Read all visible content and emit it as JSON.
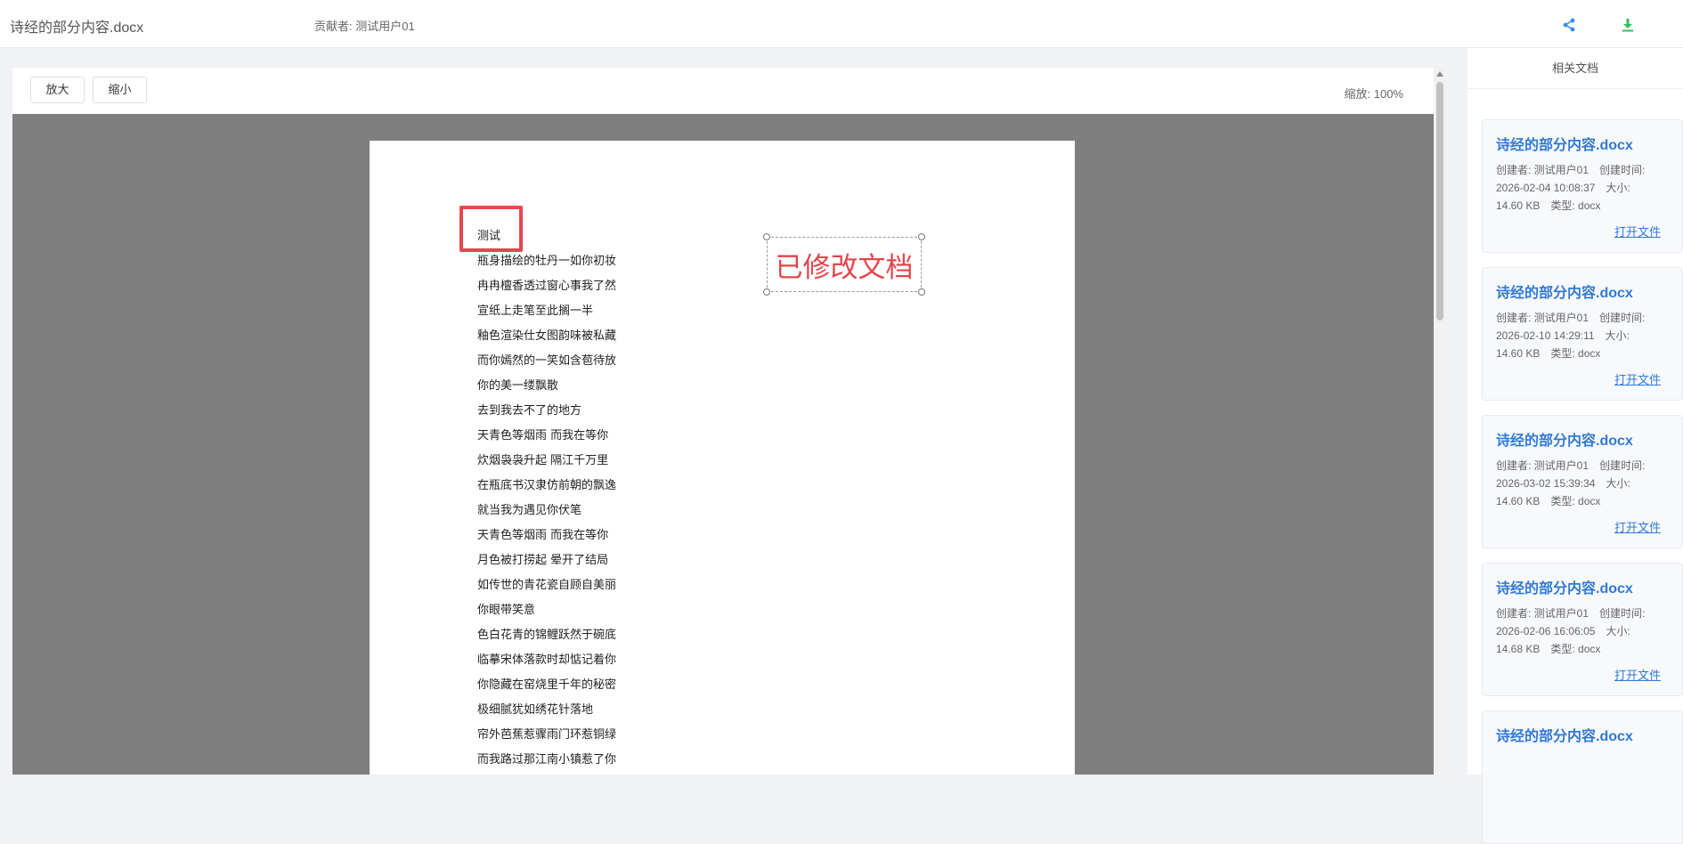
{
  "header": {
    "doc_title": "诗经的部分内容.docx",
    "contributor": "贡献者: 测试用户01",
    "share_icon": "share-icon",
    "download_icon": "download-icon",
    "colors": {
      "share": "#3a8ee6",
      "download": "#3cba5b"
    }
  },
  "toolbar": {
    "zoom_in_label": "放大",
    "zoom_out_label": "缩小",
    "zoom_level": "缩放: 100%"
  },
  "document": {
    "highlight_text": "测试",
    "stamp_text": "已修改文档",
    "lines": [
      "瓶身描绘的牡丹一如你初妆",
      "冉冉檀香透过窗心事我了然",
      "宣纸上走笔至此搁一半",
      "釉色渲染仕女图韵味被私藏",
      "而你嫣然的一笑如含苞待放",
      "你的美一缕飘散",
      "去到我去不了的地方",
      "天青色等烟雨 而我在等你",
      "炊烟袅袅升起 隔江千万里",
      "在瓶底书汉隶仿前朝的飘逸",
      "就当我为遇见你伏笔",
      "天青色等烟雨 而我在等你",
      "月色被打捞起 晕开了结局",
      "如传世的青花瓷自顾自美丽",
      "你眼带笑意",
      "色白花青的锦鲤跃然于碗底",
      "临摹宋体落款时却惦记着你",
      "你隐藏在窑烧里千年的秘密",
      "极细腻犹如绣花针落地",
      "帘外芭蕉惹骤雨门环惹铜绿",
      "而我路过那江南小镇惹了你"
    ]
  },
  "sidebar": {
    "title": "相关文档",
    "cards": [
      {
        "title": "诗经的部分内容.docx",
        "meta1": "创建者: 测试用户01　创建时间:",
        "meta2": "2026-02-04 10:08:37　大小:",
        "meta3": "14.60 KB　类型: docx",
        "link": "打开文件"
      },
      {
        "title": "诗经的部分内容.docx",
        "meta1": "创建者: 测试用户01　创建时间:",
        "meta2": "2026-02-10 14:29:11　大小:",
        "meta3": "14.60 KB　类型: docx",
        "link": "打开文件"
      },
      {
        "title": "诗经的部分内容.docx",
        "meta1": "创建者: 测试用户01　创建时间:",
        "meta2": "2026-03-02 15:39:34　大小:",
        "meta3": "14.60 KB　类型: docx",
        "link": "打开文件"
      },
      {
        "title": "诗经的部分内容.docx",
        "meta1": "创建者: 测试用户01　创建时间:",
        "meta2": "2026-02-06 16:06:05　大小:",
        "meta3": "14.68 KB　类型: docx",
        "link": "打开文件"
      },
      {
        "title": "诗经的部分内容.docx"
      }
    ]
  }
}
